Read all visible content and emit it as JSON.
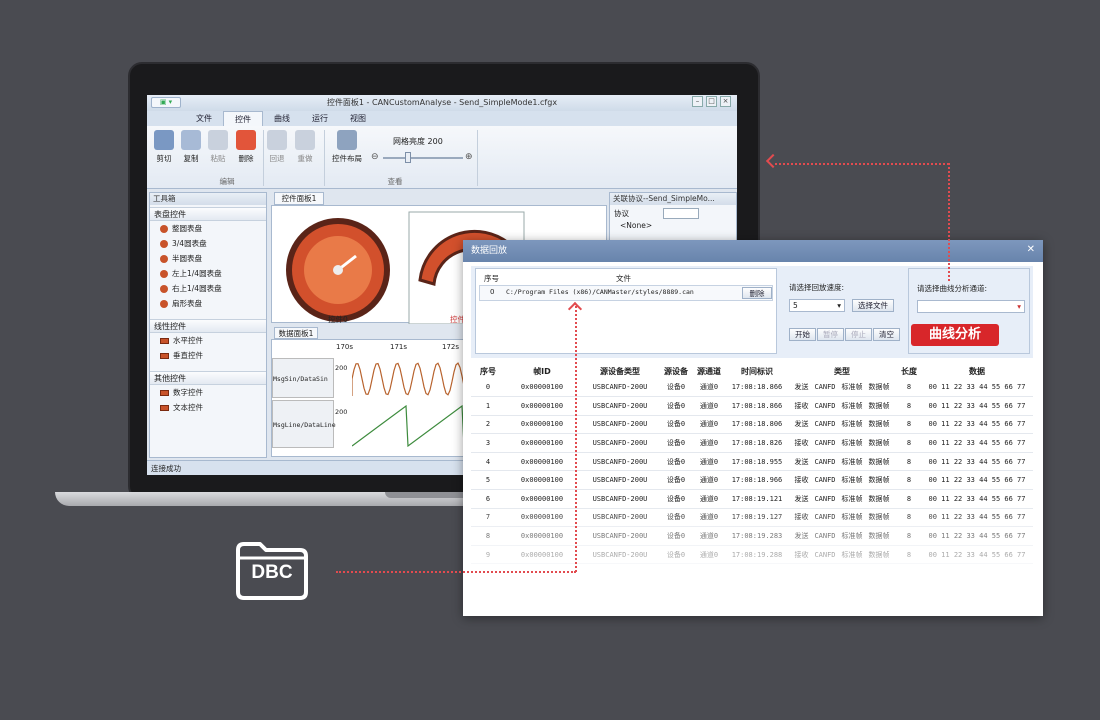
{
  "window": {
    "title": "控件面板1 - CANCustomAnalyse - Send_SimpleMode1.cfgx"
  },
  "ribbon": {
    "tabs": [
      "文件",
      "控件",
      "曲线",
      "运行",
      "视图"
    ],
    "buttons": {
      "cut": "剪切",
      "copy": "复制",
      "paste": "粘贴",
      "delete": "删除",
      "undo": "回退",
      "redo": "重做",
      "layout": "控件布局"
    },
    "grid_brightness_label": "网格亮度 200",
    "group_edit": "编辑",
    "group_view": "查看"
  },
  "toolbox": {
    "title": "工具箱",
    "sections": [
      {
        "label": "表盘控件",
        "items": [
          "整圆表盘",
          "3/4圆表盘",
          "半圆表盘",
          "左上1/4圆表盘",
          "右上1/4圆表盘",
          "扇形表盘"
        ]
      },
      {
        "label": "线性控件",
        "items": [
          "水平控件",
          "垂直控件"
        ]
      },
      {
        "label": "其他控件",
        "items": [
          "数字控件",
          "文本控件"
        ]
      }
    ]
  },
  "panels": {
    "control_tab": "控件面板1",
    "control_caption_1": "控件0",
    "control_caption_2": "控件",
    "data_tab": "数据面板1",
    "time_ticks": [
      "170s",
      "171s",
      "172s"
    ],
    "signals": [
      {
        "name": "MsgSin/DataSin",
        "ymax": "200"
      },
      {
        "name": "MsgLine/DataLine",
        "ymax": "200"
      }
    ]
  },
  "protocol_pane": {
    "title": "关联协议--Send_SimpleMo...",
    "protocol_label": "协议",
    "node": "<None>"
  },
  "status": {
    "text": "连接成功"
  },
  "dialog": {
    "title": "数据回放",
    "file_table": {
      "headers": [
        "序号",
        "文件"
      ],
      "row": {
        "index": "0",
        "path": "C:/Program Files (x86)/CANMaster/styles/8889.can",
        "delete": "删除"
      }
    },
    "speed_label": "请选择回放速度:",
    "speed_value": "5",
    "select_file": "选择文件",
    "controls": {
      "start": "开始",
      "pause": "暂停",
      "stop": "停止",
      "clear": "清空"
    },
    "channel_label": "请选择曲线分析通道:",
    "cta": "曲线分析",
    "columns": [
      "序号",
      "帧ID",
      "源设备类型",
      "源设备",
      "源通道",
      "时间标识",
      "类型",
      "长度",
      "数据"
    ],
    "frame_types": [
      "CANFD",
      "标准帧",
      "数据帧"
    ],
    "rows": [
      {
        "index": "0",
        "id": "0x00000100",
        "devtype": "USBCANFD-200U",
        "dev": "设备0",
        "ch": "通道0",
        "time": "17:08:18.866",
        "dir": "发送",
        "len": "8",
        "data": "00 11 22 33 44 55 66 77"
      },
      {
        "index": "1",
        "id": "0x00000100",
        "devtype": "USBCANFD-200U",
        "dev": "设备0",
        "ch": "通道0",
        "time": "17:08:18.866",
        "dir": "接收",
        "len": "8",
        "data": "00 11 22 33 44 55 66 77"
      },
      {
        "index": "2",
        "id": "0x00000100",
        "devtype": "USBCANFD-200U",
        "dev": "设备0",
        "ch": "通道0",
        "time": "17:08:18.806",
        "dir": "发送",
        "len": "8",
        "data": "00 11 22 33 44 55 66 77"
      },
      {
        "index": "3",
        "id": "0x00000100",
        "devtype": "USBCANFD-200U",
        "dev": "设备0",
        "ch": "通道0",
        "time": "17:08:18.826",
        "dir": "接收",
        "len": "8",
        "data": "00 11 22 33 44 55 66 77"
      },
      {
        "index": "4",
        "id": "0x00000100",
        "devtype": "USBCANFD-200U",
        "dev": "设备0",
        "ch": "通道0",
        "time": "17:08:18.955",
        "dir": "发送",
        "len": "8",
        "data": "00 11 22 33 44 55 66 77"
      },
      {
        "index": "5",
        "id": "0x00000100",
        "devtype": "USBCANFD-200U",
        "dev": "设备0",
        "ch": "通道0",
        "time": "17:08:18.966",
        "dir": "接收",
        "len": "8",
        "data": "00 11 22 33 44 55 66 77"
      },
      {
        "index": "6",
        "id": "0x00000100",
        "devtype": "USBCANFD-200U",
        "dev": "设备0",
        "ch": "通道0",
        "time": "17:08:19.121",
        "dir": "发送",
        "len": "8",
        "data": "00 11 22 33 44 55 66 77"
      },
      {
        "index": "7",
        "id": "0x00000100",
        "devtype": "USBCANFD-200U",
        "dev": "设备0",
        "ch": "通道0",
        "time": "17:08:19.127",
        "dir": "接收",
        "len": "8",
        "data": "00 11 22 33 44 55 66 77"
      },
      {
        "index": "8",
        "id": "0x00000100",
        "devtype": "USBCANFD-200U",
        "dev": "设备0",
        "ch": "通道0",
        "time": "17:08:19.283",
        "dir": "发送",
        "len": "8",
        "data": "00 11 22 33 44 55 66 77"
      },
      {
        "index": "9",
        "id": "0x00000100",
        "devtype": "USBCANFD-200U",
        "dev": "设备0",
        "ch": "通道0",
        "time": "17:08:19.288",
        "dir": "接收",
        "len": "8",
        "data": "00 11 22 33 44 55 66 77"
      }
    ]
  },
  "dbc_badge": "DBC",
  "colors": {
    "accent_red": "#d8262a",
    "dialog_title": "#6f8ab1",
    "arrow": "#e24b4f",
    "background": "#4a4b51"
  }
}
